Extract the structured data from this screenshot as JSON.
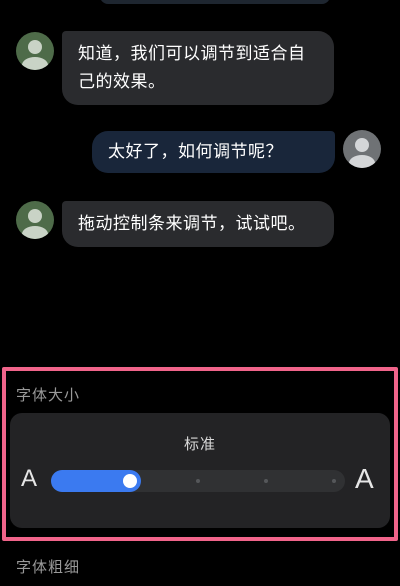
{
  "chat": {
    "messages": [
      {
        "sender": "bot",
        "text": "知道，我们可以调节到适合自己的效果。"
      },
      {
        "sender": "user",
        "text": "太好了，如何调节呢？"
      },
      {
        "sender": "bot",
        "text": "拖动控制条来调节，试试吧。"
      }
    ]
  },
  "font_size": {
    "section_label": "字体大小",
    "current_label": "标准",
    "small_glyph": "A",
    "large_glyph": "A",
    "steps": 5,
    "selected_step": 1,
    "accent_color": "#3b7af0"
  },
  "font_weight": {
    "section_label": "字体粗细"
  },
  "colors": {
    "bot_bubble": "#2a2b2e",
    "user_bubble": "#19263a",
    "highlight": "#f0648a"
  },
  "icons": {
    "bot_avatar": "user-avatar-icon",
    "user_avatar": "user-avatar-icon"
  }
}
